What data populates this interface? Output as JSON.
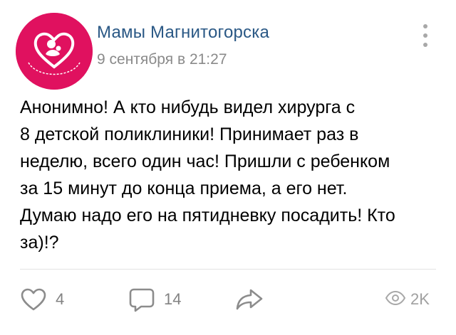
{
  "post": {
    "author": "Мамы Магнитогорска",
    "date": "9 сентября в 21:27",
    "avatar_text": "Мамы Магнитогорска",
    "text_lines": [
      "Анонимно! А кто нибудь видел хирурга с",
      "8 детской поликлиники! Принимает раз в",
      "неделю,  всего один час!  Пришли с ребенком",
      "за 15 минут до конца приема,  а его нет.",
      "Думаю надо его на пятидневку посадить!  Кто",
      "за)!?"
    ]
  },
  "footer": {
    "likes": "4",
    "comments": "14",
    "views": "2K"
  },
  "icons": {
    "menu": "more-vertical-icon",
    "like": "heart-icon",
    "comment": "comment-icon",
    "share": "share-arrow-icon",
    "views": "eye-icon"
  },
  "colors": {
    "author": "#2a5885",
    "avatar_bg": "#e0115f",
    "muted": "#828282"
  }
}
